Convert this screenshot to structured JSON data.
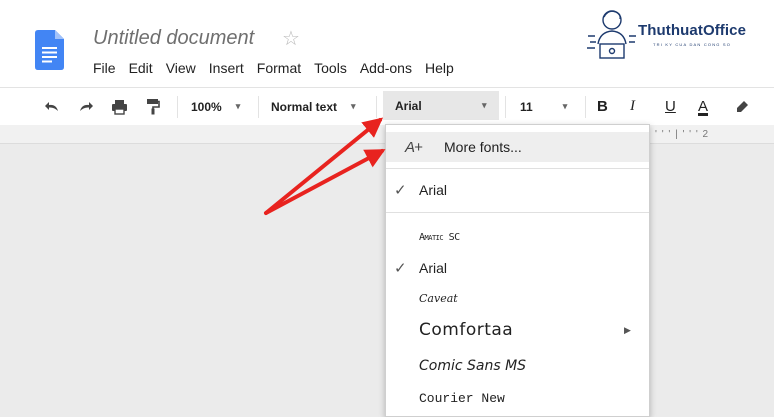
{
  "document": {
    "title": "Untitled document"
  },
  "menu": [
    "File",
    "Edit",
    "View",
    "Insert",
    "Format",
    "Tools",
    "Add-ons",
    "Help"
  ],
  "brand": {
    "name": "ThuthuatOffice",
    "tagline": "TRI KY CUA DAN CONG SO"
  },
  "toolbar": {
    "zoom": "100%",
    "style": "Normal text",
    "font": "Arial",
    "font_size": "11",
    "bold": "B",
    "italic": "I",
    "underline": "U",
    "text_color": "A"
  },
  "ruler": {
    "marks": "' ' ' | ' ' ' 2"
  },
  "font_menu": {
    "more_fonts_icon": "A+",
    "more_fonts": "More fonts...",
    "recent": [
      {
        "name": "Arial",
        "checked": true
      }
    ],
    "fonts": [
      {
        "name": "Amatic SC",
        "checked": false
      },
      {
        "name": "Arial",
        "checked": true
      },
      {
        "name": "Caveat",
        "checked": false
      },
      {
        "name": "Comfortaa",
        "checked": false,
        "submenu": true
      },
      {
        "name": "Comic Sans MS",
        "checked": false
      },
      {
        "name": "Courier New",
        "checked": false
      }
    ],
    "check_glyph": "✓",
    "submenu_glyph": "▶"
  },
  "colors": {
    "annotation_arrow": "#e8231f",
    "docs_blue": "#4285f4",
    "brand_navy": "#1d3a6e"
  }
}
